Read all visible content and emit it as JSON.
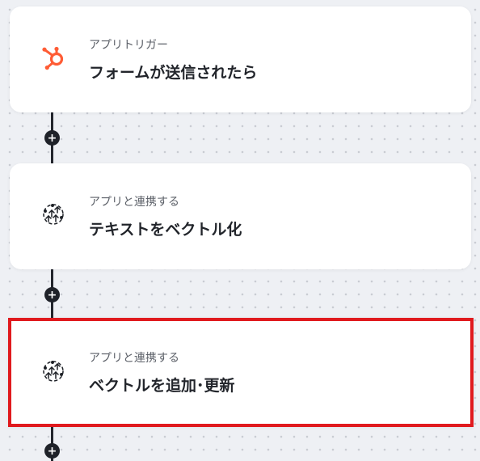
{
  "flow": {
    "steps": [
      {
        "category": "アプリトリガー",
        "title": "フォームが送信されたら",
        "icon": "hubspot-icon"
      },
      {
        "category": "アプリと連携する",
        "title": "テキストをベクトル化",
        "icon": "ai-vector-icon"
      },
      {
        "category": "アプリと連携する",
        "title": "ベクトルを追加･更新",
        "icon": "ai-vector-icon"
      }
    ],
    "add_symbol": "+"
  },
  "colors": {
    "background": "#eef0f4",
    "card": "#ffffff",
    "connector": "#23262d",
    "hubspot_orange": "#ff5c35",
    "selection_border": "#e01a1e"
  }
}
